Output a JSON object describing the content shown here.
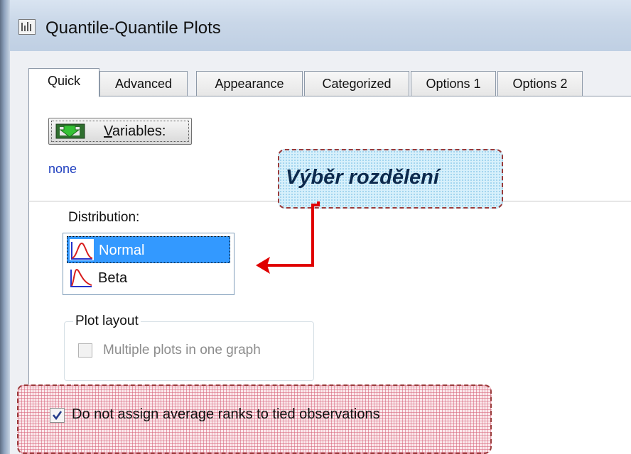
{
  "window": {
    "title": "Quantile-Quantile Plots",
    "icon": "chart-window-icon"
  },
  "tabs": [
    {
      "label": "Quick",
      "active": true
    },
    {
      "label": "Advanced",
      "active": false
    },
    {
      "label": "Appearance",
      "active": false
    },
    {
      "label": "Categorized",
      "active": false
    },
    {
      "label": "Options 1",
      "active": false
    },
    {
      "label": "Options 2",
      "active": false
    }
  ],
  "variables": {
    "button_label": "Variables:",
    "mnemonic": "V",
    "icon": "variables-icon",
    "value": "none"
  },
  "distribution": {
    "label": "Distribution:",
    "options": [
      {
        "label": "Normal",
        "selected": true,
        "icon": "normal-curve-icon"
      },
      {
        "label": "Beta",
        "selected": false,
        "icon": "beta-curve-icon"
      }
    ]
  },
  "plot_layout": {
    "title": "Plot layout",
    "multiple_plots_label": "Multiple plots in one graph",
    "multiple_plots_checked": false,
    "enabled": false
  },
  "tied": {
    "label": "Do not assign average ranks to tied observations",
    "checked": true
  },
  "annotation": {
    "text": "Výběr rozdělení",
    "arrow_color": "#e00000"
  },
  "colors": {
    "selection": "#3399ff",
    "link_text": "#1f3fbf",
    "callout_border": "#9a3b3b"
  }
}
